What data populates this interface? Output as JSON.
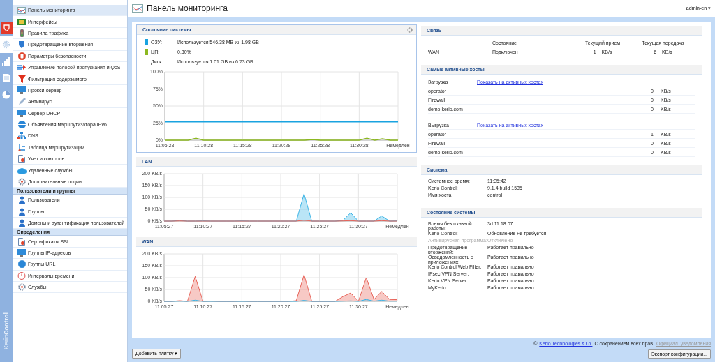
{
  "brand": "Kerio**Control**",
  "rail_tabs": [
    {
      "selected": false
    },
    {
      "selected": true
    },
    {
      "selected": false
    },
    {
      "selected": false
    },
    {
      "selected": false
    }
  ],
  "nav": [
    {
      "kind": "item",
      "label": "Панель мониторинга",
      "selected": true
    },
    {
      "kind": "item",
      "label": "Интерфейсы",
      "selected": false
    },
    {
      "kind": "item",
      "label": "Правила трафика",
      "selected": false
    },
    {
      "kind": "item",
      "label": "Предотвращение вторжения",
      "selected": false
    },
    {
      "kind": "item",
      "label": "Параметры безопасности",
      "selected": false
    },
    {
      "kind": "item",
      "label": "Управление полосой пропускания и QoS",
      "selected": false
    },
    {
      "kind": "item",
      "label": "Фильтрация содержимого",
      "selected": false
    },
    {
      "kind": "item",
      "label": "Прокси-сервер",
      "selected": false
    },
    {
      "kind": "item",
      "label": "Антивирус",
      "selected": false
    },
    {
      "kind": "item",
      "label": "Сервер DHCP",
      "selected": false
    },
    {
      "kind": "item",
      "label": "Объявления маршрутизатора IPv6",
      "selected": false
    },
    {
      "kind": "item",
      "label": "DNS",
      "selected": false
    },
    {
      "kind": "item",
      "label": "Таблица маршрутизации",
      "selected": false
    },
    {
      "kind": "item",
      "label": "Учет и контроль",
      "selected": false
    },
    {
      "kind": "item",
      "label": "Удаленные службы",
      "selected": false
    },
    {
      "kind": "item",
      "label": "Дополнительные опции",
      "selected": false
    },
    {
      "kind": "header",
      "label": "Пользователи и группы"
    },
    {
      "kind": "item",
      "label": "Пользователи",
      "selected": false
    },
    {
      "kind": "item",
      "label": "Группы",
      "selected": false
    },
    {
      "kind": "item",
      "label": "Домены и аутентификация пользователей",
      "selected": false
    },
    {
      "kind": "header",
      "label": "Определения"
    },
    {
      "kind": "item",
      "label": "Сертификаты SSL",
      "selected": false
    },
    {
      "kind": "item",
      "label": "Группы IP-адресов",
      "selected": false
    },
    {
      "kind": "item",
      "label": "Группы URL",
      "selected": false
    },
    {
      "kind": "item",
      "label": "Интервалы времени",
      "selected": false
    },
    {
      "kind": "item",
      "label": "Службы",
      "selected": false
    }
  ],
  "header": {
    "title": "Панель мониторинга",
    "user": "admin-en",
    "user_caret": "▾"
  },
  "system_card": {
    "title": "Состояние системы",
    "legend": [
      {
        "label": "ОЗУ:",
        "value": "Используется 546.38 MB из 1.98 GB",
        "color": "#1aa3e0"
      },
      {
        "label": "ЦП:",
        "value": "0.30%",
        "color": "#8cb820"
      },
      {
        "label": "Диск:",
        "value": "Используется 1.01 GB из 6.73 GB"
      }
    ],
    "chart_data": {
      "type": "line",
      "grid": true,
      "ylim": [
        0,
        100
      ],
      "categories": [
        "11:05:28",
        null,
        null,
        null,
        null,
        "11:10:28",
        null,
        null,
        null,
        null,
        "11:15:28",
        null,
        null,
        null,
        null,
        "11:20:28",
        null,
        null,
        null,
        null,
        "11:25:28",
        null,
        null,
        null,
        null,
        "11:30:28",
        null,
        null,
        null,
        null,
        "Немедлен"
      ],
      "yticks": [
        {
          "value": 0,
          "label": "0%"
        },
        {
          "value": 25,
          "label": "25%"
        },
        {
          "value": 50,
          "label": "50%"
        },
        {
          "value": 75,
          "label": "75%"
        },
        {
          "value": 100,
          "label": "100%"
        }
      ],
      "series": [
        {
          "color": "#1aa3e0",
          "values": [
            27,
            27,
            27,
            27,
            27,
            27,
            27,
            27,
            27,
            27,
            27,
            27,
            27,
            27,
            27,
            27,
            27,
            27,
            27,
            27,
            27,
            27,
            27,
            27,
            27,
            27,
            27,
            27,
            27,
            27,
            27
          ]
        },
        {
          "color": "#8cb820",
          "values": [
            0,
            0,
            0,
            0,
            3,
            0,
            0,
            0,
            0,
            0,
            0,
            0,
            0,
            0,
            0,
            0,
            0,
            0,
            0,
            1,
            0,
            0,
            0,
            0,
            0,
            0,
            3,
            0,
            2,
            0,
            0
          ]
        }
      ]
    }
  },
  "lan": {
    "title": "LAN",
    "chart_data": {
      "type": "area",
      "grid": true,
      "ylim": [
        0,
        200
      ],
      "categories": [
        "11:05:27",
        null,
        null,
        null,
        null,
        "11:10:27",
        null,
        null,
        null,
        null,
        "11:15:27",
        null,
        null,
        null,
        null,
        "11:20:27",
        null,
        null,
        null,
        null,
        "11:25:27",
        null,
        null,
        null,
        null,
        "11:30:27",
        null,
        null,
        null,
        null,
        "Немедлен"
      ],
      "yticks": [
        {
          "value": 0,
          "label": "0 KB/s"
        },
        {
          "value": 50,
          "label": "50 KB/s"
        },
        {
          "value": 100,
          "label": "100 KB/s"
        },
        {
          "value": 150,
          "label": "150 KB/s"
        },
        {
          "value": 200,
          "label": "200 KB/s"
        }
      ],
      "series": [
        {
          "color": "#3ab4e6",
          "values": [
            0,
            0,
            3,
            0,
            0,
            1,
            0,
            0,
            0,
            0,
            1,
            0,
            0,
            0,
            0,
            0,
            0,
            0,
            115,
            0,
            0,
            0,
            0,
            3,
            35,
            0,
            0,
            0,
            22,
            0,
            1
          ]
        },
        {
          "color": "#e8645a",
          "values": [
            0,
            0,
            1,
            0,
            0,
            0,
            0,
            0,
            0,
            0,
            0,
            0,
            0,
            0,
            0,
            0,
            0,
            0,
            4,
            0,
            0,
            0,
            0,
            1,
            2,
            0,
            0,
            0,
            2,
            0,
            0
          ]
        }
      ]
    }
  },
  "wan": {
    "title": "WAN",
    "chart_data": {
      "type": "area",
      "grid": true,
      "ylim": [
        0,
        200
      ],
      "categories": [
        "11:05:27",
        null,
        null,
        null,
        null,
        "11:10:27",
        null,
        null,
        null,
        null,
        "11:15:27",
        null,
        null,
        null,
        null,
        "11:20:27",
        null,
        null,
        null,
        null,
        "11:25:27",
        null,
        null,
        null,
        null,
        "11:30:27",
        null,
        null,
        null,
        null,
        "Немедлен"
      ],
      "yticks": [
        {
          "value": 0,
          "label": "0 KB/s"
        },
        {
          "value": 50,
          "label": "50 KB/s"
        },
        {
          "value": 100,
          "label": "100 KB/s"
        },
        {
          "value": 150,
          "label": "150 KB/s"
        },
        {
          "value": 200,
          "label": "200 KB/s"
        }
      ],
      "series": [
        {
          "color": "#e8645a",
          "values": [
            0,
            0,
            3,
            0,
            105,
            0,
            1,
            0,
            0,
            0,
            1,
            0,
            0,
            0,
            0,
            0,
            0,
            3,
            112,
            0,
            0,
            0,
            0,
            20,
            35,
            0,
            100,
            8,
            42,
            8,
            7
          ]
        },
        {
          "color": "#3ab4e6",
          "values": [
            0,
            0,
            1,
            0,
            5,
            0,
            0,
            0,
            0,
            0,
            0,
            0,
            0,
            0,
            0,
            0,
            0,
            0,
            4,
            0,
            0,
            0,
            0,
            1,
            2,
            0,
            8,
            1,
            5,
            1,
            1
          ]
        }
      ]
    }
  },
  "connection": {
    "title": "Связь",
    "columns": [
      "Состояние",
      "Текущий прием",
      "Текущая передача"
    ],
    "rows": [
      {
        "name": "WAN",
        "state": "Подключен",
        "rx": "1",
        "rx_unit": "KB/s",
        "tx": "6",
        "tx_unit": "KB/s"
      }
    ]
  },
  "hosts": {
    "title": "Самые активные хосты",
    "groups": [
      {
        "label": "Загрузка",
        "link": "Показать на активных хостах",
        "rows": [
          {
            "host": "operator",
            "value": "0",
            "unit": "KB/s"
          },
          {
            "host": "Firewall",
            "value": "0",
            "unit": "KB/s"
          },
          {
            "host": "demo.kerio.com",
            "value": "0",
            "unit": "KB/s"
          }
        ]
      },
      {
        "label": "Выгрузка",
        "link": "Показать на активных хостах",
        "rows": [
          {
            "host": "operator",
            "value": "1",
            "unit": "KB/s"
          },
          {
            "host": "Firewall",
            "value": "0",
            "unit": "KB/s"
          },
          {
            "host": "demo.kerio.com",
            "value": "0",
            "unit": "KB/s"
          }
        ]
      }
    ]
  },
  "system": {
    "title": "Система",
    "rows": [
      {
        "label": "Системное время:",
        "value": "11:35:42"
      },
      {
        "label": "Kerio Control:",
        "value": "9.1.4 build 1535"
      },
      {
        "label": "Имя хоста:",
        "value": "control"
      }
    ]
  },
  "status": {
    "title": "Состояние системы",
    "rows": [
      {
        "label": "Время безотказной работы:",
        "value": "3d 11:18:07",
        "disabled": false
      },
      {
        "label": "Kerio Control:",
        "value": "Обновление не требуется",
        "disabled": false
      },
      {
        "label": "Антивирусная программа:",
        "value": "Отключено",
        "disabled": true
      },
      {
        "label": "Предотвращение вторжений:",
        "value": "Работает правильно",
        "disabled": false
      },
      {
        "label": "Осведомленность о приложениях:",
        "value": "Работает правильно",
        "disabled": false
      },
      {
        "label": "Kerio Control Web Filter:",
        "value": "Работает правильно",
        "disabled": false
      },
      {
        "label": "IPsec VPN Server:",
        "value": "Работает правильно",
        "disabled": false
      },
      {
        "label": "Kerio VPN Server:",
        "value": "Работает правильно",
        "disabled": false
      },
      {
        "label": "MyKerio:",
        "value": "Работает правильно",
        "disabled": false
      }
    ]
  },
  "footer": {
    "copyright_sign": "©",
    "company_link": "Kerio Technologies s.r.o.",
    "rights": "С сохранением всех прав.",
    "notices_link": "Официал. уведомления",
    "add_tile_button": "Добавить плитку",
    "add_tile_caret": "▾",
    "export_button": "Экспорт конфигурации..."
  }
}
